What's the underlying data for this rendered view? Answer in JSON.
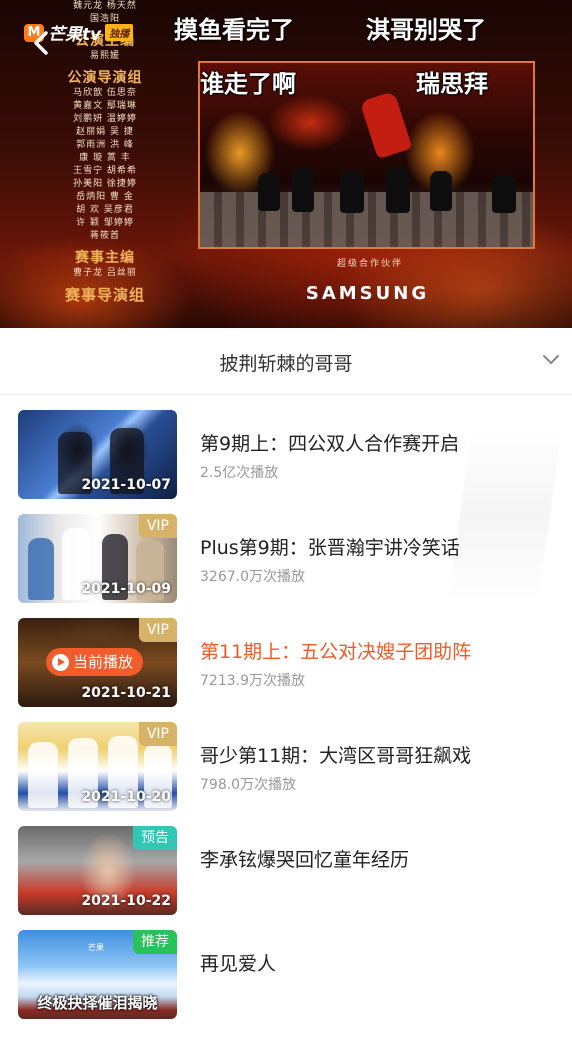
{
  "player": {
    "logo_mark": "M",
    "logo_brand": "芒果tv",
    "logo_tag": "独播",
    "back_icon": "chevron-left-icon",
    "credits": [
      {
        "type": "names",
        "text": "魏元龙  杨天然"
      },
      {
        "type": "names",
        "text": "国浩阳"
      },
      {
        "type": "title",
        "text": "公演主编"
      },
      {
        "type": "names",
        "text": "易熙媛"
      },
      {
        "type": "title",
        "text": "公演导演组"
      },
      {
        "type": "names",
        "text": "马欣歆  伍思奈"
      },
      {
        "type": "names",
        "text": "黄嘉文  鄢瑞琳"
      },
      {
        "type": "names",
        "text": "刘鹏妍  温婷婷"
      },
      {
        "type": "names",
        "text": "赵丽娟  吴  捷"
      },
      {
        "type": "names",
        "text": "郭雨洲  洪  峰"
      },
      {
        "type": "names",
        "text": "康  璇  蒿  丰"
      },
      {
        "type": "names",
        "text": "王雪宁  胡希希"
      },
      {
        "type": "names",
        "text": "孙美阳  徐捷婷"
      },
      {
        "type": "names",
        "text": "岳炳阳  曹  金"
      },
      {
        "type": "names",
        "text": "胡  欢  吴彦君"
      },
      {
        "type": "names",
        "text": "许  颖  邹婷婷"
      },
      {
        "type": "names",
        "text": "蒋筱首"
      },
      {
        "type": "title",
        "text": "赛事主编"
      },
      {
        "type": "names",
        "text": "曹子龙  吕丝丽"
      },
      {
        "type": "title_big",
        "text": "赛事导演组"
      }
    ],
    "danmaku": [
      {
        "text": "摸鱼看完了",
        "style": "dark"
      },
      {
        "text": "淇哥别哭了",
        "style": "dark"
      },
      {
        "text": "谁走了啊",
        "style": "light"
      },
      {
        "text": "瑞思拜",
        "style": "light"
      }
    ],
    "sponsor_caption": "超级合作伙伴",
    "sponsor_name": "SAMSUNG"
  },
  "series": {
    "title": "披荆斩棘的哥哥",
    "expand_icon": "chevron-down-icon"
  },
  "episodes": [
    {
      "title": "第9期上：四公双人合作赛开启",
      "plays": "2.5亿次播放",
      "date": "2021-10-07",
      "badge": "",
      "badge_type": "",
      "active": false
    },
    {
      "title": "Plus第9期：张晋瀚宇讲冷笑话",
      "plays": "3267.0万次播放",
      "date": "2021-10-09",
      "badge": "VIP",
      "badge_type": "vip",
      "active": false
    },
    {
      "title": "第11期上：五公对决嫂子团助阵",
      "plays": "7213.9万次播放",
      "date": "2021-10-21",
      "badge": "VIP",
      "badge_type": "vip",
      "active": true,
      "now_playing": "当前播放"
    },
    {
      "title": "哥少第11期：大湾区哥哥狂飙戏",
      "plays": "798.0万次播放",
      "date": "2021-10-20",
      "badge": "VIP",
      "badge_type": "vip",
      "active": false
    },
    {
      "title": "李承铉爆哭回忆童年经历",
      "plays": "",
      "date": "2021-10-22",
      "badge": "预告",
      "badge_type": "preview",
      "active": false
    },
    {
      "title": "再见爱人",
      "plays": "",
      "date": "",
      "badge": "推荐",
      "badge_type": "recommend",
      "active": false,
      "thumb_caption": "终极抉择催泪揭晓",
      "thumb_brand": "芒果"
    }
  ],
  "colors": {
    "accent_active": "#f05a28",
    "vip_badge": "#d7b36a",
    "preview_badge": "#33c6b4",
    "recommend_badge": "#28c25a"
  }
}
